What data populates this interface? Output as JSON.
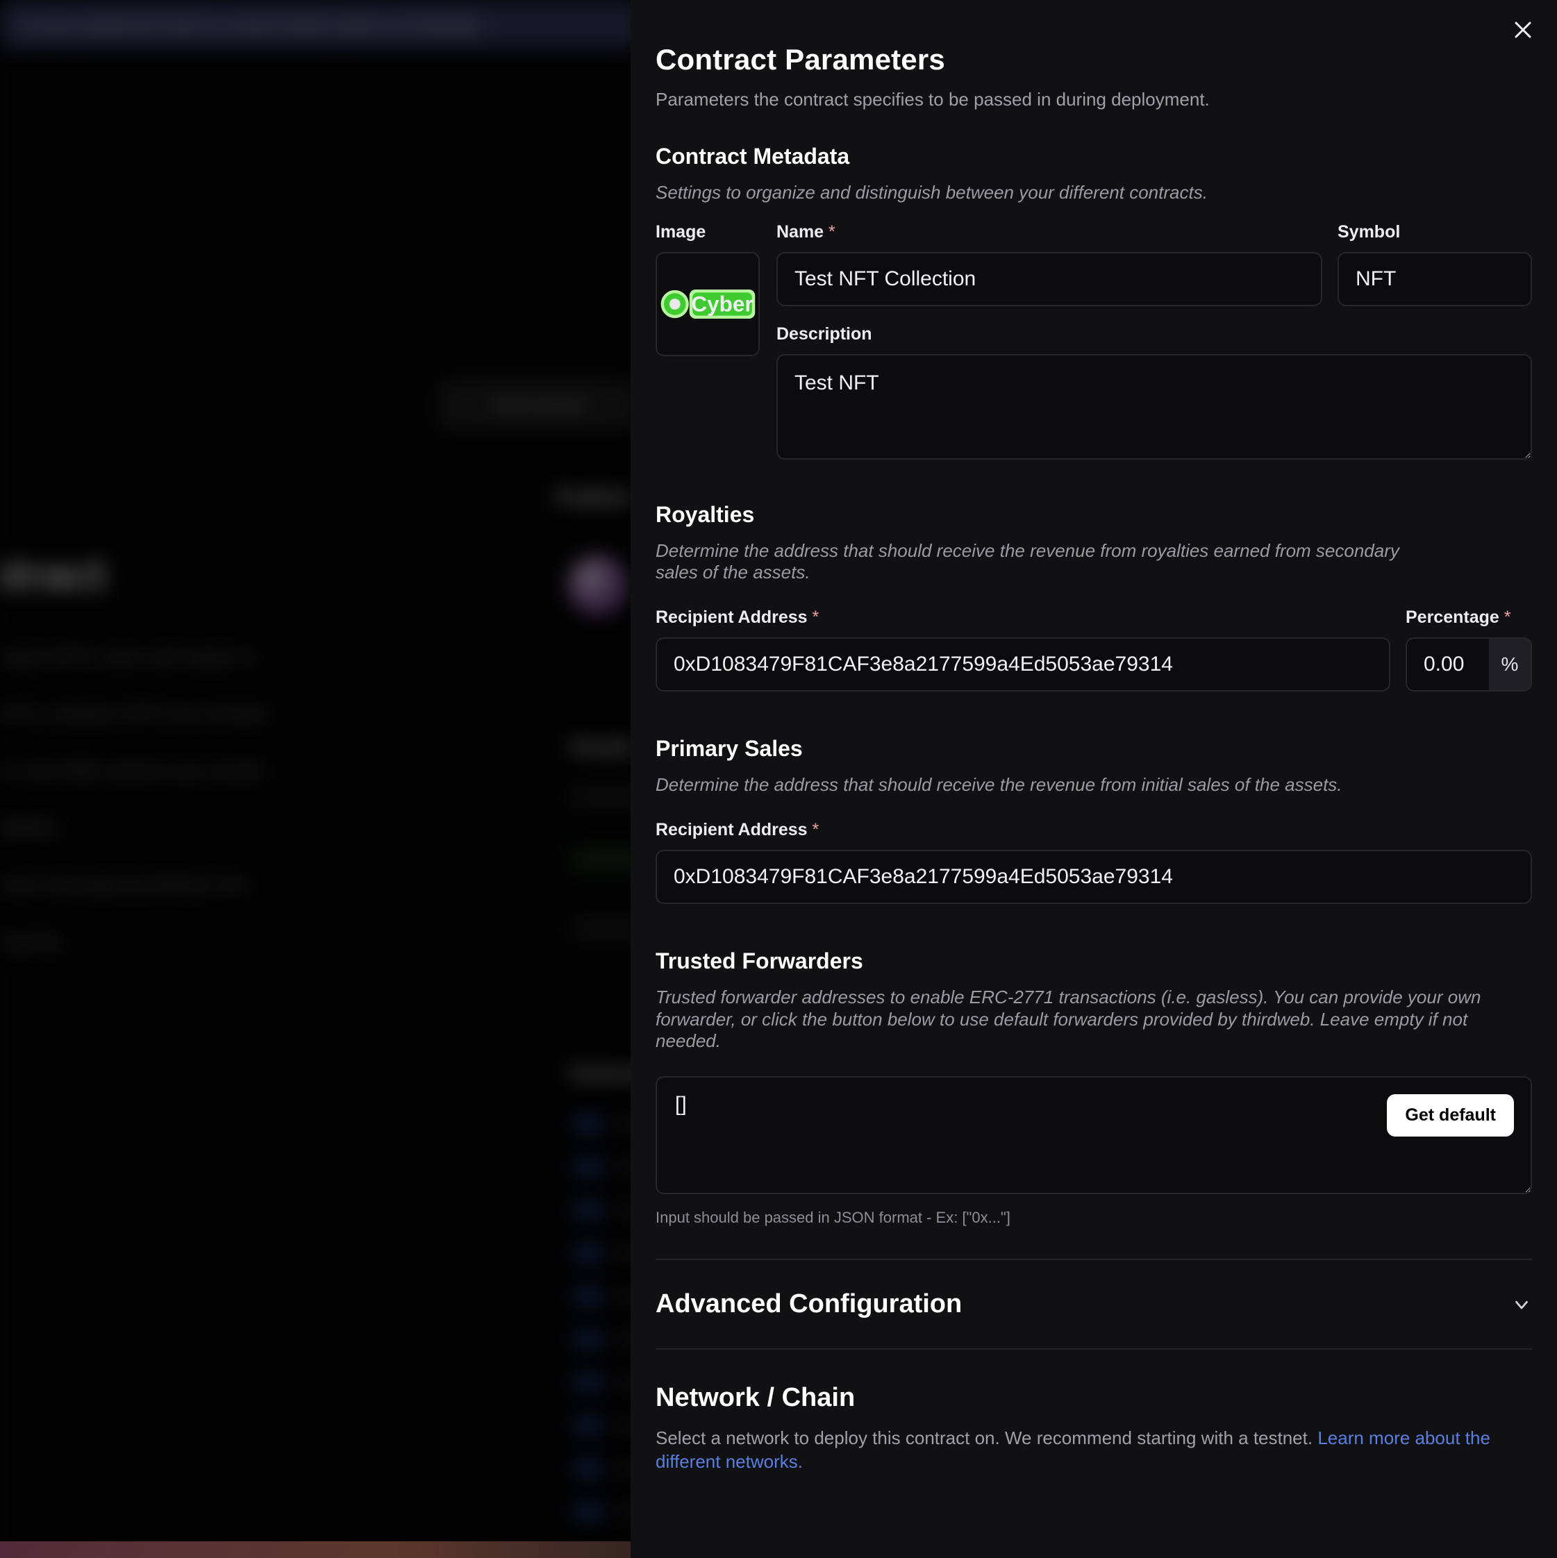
{
  "background": {
    "banner_text": "to your preferred chain to unlock better paths on thirdweb",
    "deploy_button": "Add reward",
    "page_title": "Contract",
    "paragraph_lines": [
      "A collection of unique NFTs, also call 'large' or",
      "copy mint your NFTs, instead, NFTs are minted",
      "these and perform one-offer actions you would",
      "our minting capabilities",
      "are launches creator earnings by default, the",
      "recipient, by editing the"
    ],
    "right_col_title": "Publish",
    "section2_title": "Details",
    "section3_title": "Extensions"
  },
  "panel": {
    "close_icon": "close-icon",
    "title": "Contract Parameters",
    "subtitle": "Parameters the contract specifies to be passed in during deployment.",
    "metadata": {
      "heading": "Contract Metadata",
      "description": "Settings to organize and distinguish between your different contracts.",
      "image_label": "Image",
      "image_alt": "Cyber",
      "image_logo_text": "Cyber",
      "name_label": "Name",
      "name_required": "*",
      "name_value": "Test NFT Collection",
      "name_placeholder": "Name",
      "symbol_label": "Symbol",
      "symbol_value": "NFT",
      "symbol_placeholder": "Symbol",
      "description_label": "Description",
      "description_value": "Test NFT",
      "description_placeholder": "Description"
    },
    "royalties": {
      "heading": "Royalties",
      "description": "Determine the address that should receive the revenue from royalties earned from secondary sales of the assets.",
      "recipient_label": "Recipient Address",
      "recipient_required": "*",
      "recipient_value": "0xD1083479F81CAF3e8a2177599a4Ed5053ae79314",
      "recipient_placeholder": "0x...",
      "percentage_label": "Percentage",
      "percentage_required": "*",
      "percentage_value": "0.00",
      "percentage_suffix": "%"
    },
    "primary_sales": {
      "heading": "Primary Sales",
      "description": "Determine the address that should receive the revenue from initial sales of the assets.",
      "recipient_label": "Recipient Address",
      "recipient_required": "*",
      "recipient_value": "0xD1083479F81CAF3e8a2177599a4Ed5053ae79314",
      "recipient_placeholder": "0x..."
    },
    "trusted_forwarders": {
      "heading": "Trusted Forwarders",
      "description": "Trusted forwarder addresses to enable ERC-2771 transactions (i.e. gasless). You can provide your own forwarder, or click the button below to use default forwarders provided by thirdweb. Leave empty if not needed.",
      "value": "[]",
      "placeholder": "[]",
      "get_default_label": "Get default",
      "hint": "Input should be passed in JSON format - Ex: [\"0x...\"]"
    },
    "advanced": {
      "heading": "Advanced Configuration",
      "chevron_icon": "chevron-down-icon"
    },
    "network": {
      "heading": "Network / Chain",
      "description_prefix": "Select a network to deploy this contract on. We recommend starting with a testnet. ",
      "link_text": "Learn more about the different networks."
    }
  },
  "colors": {
    "panel_bg": "#111113",
    "field_bg": "#0c0c0e",
    "border": "#26262b",
    "link": "#5a7fe0",
    "required": "#f0a0a0",
    "accent_green": "#4ccc32"
  }
}
